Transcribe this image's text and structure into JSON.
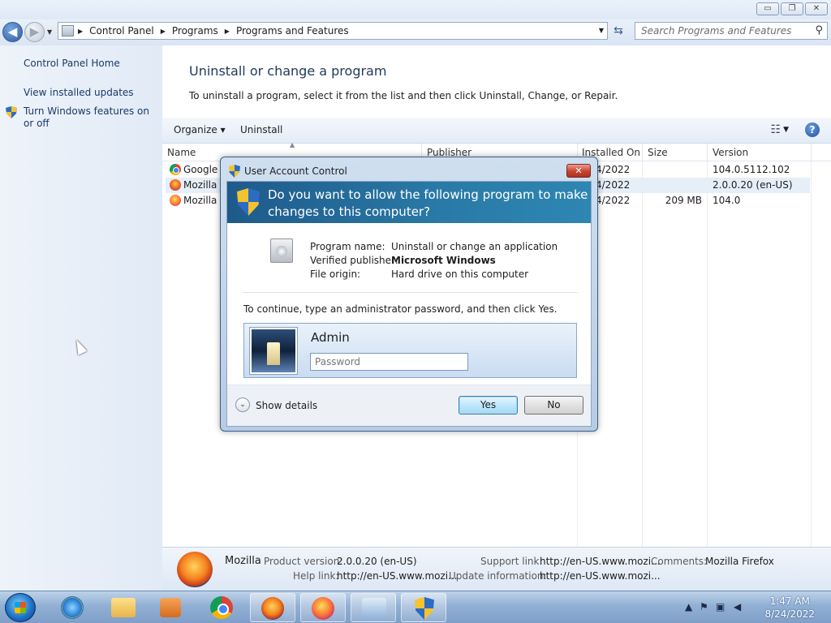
{
  "window": {
    "minimize": "▭",
    "maximize": "❐",
    "close": "✕"
  },
  "nav": {
    "back": "◀",
    "forward": "▶",
    "breadcrumbs": [
      "Control Panel",
      "Programs",
      "Programs and Features"
    ],
    "search_placeholder": "Search Programs and Features"
  },
  "sidebar": {
    "items": [
      {
        "label": "Control Panel Home"
      },
      {
        "label": "View installed updates"
      },
      {
        "label": "Turn Windows features on or off"
      }
    ]
  },
  "main": {
    "title": "Uninstall or change a program",
    "description": "To uninstall a program, select it from the list and then click Uninstall, Change, or Repair.",
    "toolbar": {
      "organize": "Organize ▾",
      "uninstall": "Uninstall",
      "help": "?"
    },
    "columns": [
      "Name",
      "Publisher",
      "Installed On",
      "Size",
      "Version"
    ],
    "rows": [
      {
        "name": "Google C",
        "installed": "4/2022",
        "size": "",
        "version": "104.0.5112.102",
        "icon": "chrome-icon"
      },
      {
        "name": "Mozilla F",
        "installed": "4/2022",
        "size": "",
        "version": "2.0.0.20 (en-US)",
        "icon": "mozilla-icon"
      },
      {
        "name": "Mozilla F",
        "installed": "4/2022",
        "size": "209 MB",
        "version": "104.0",
        "icon": "firefox-icon"
      }
    ]
  },
  "details": {
    "name": "Mozilla",
    "product_version_label": "Product version:",
    "product_version": "2.0.0.20 (en-US)",
    "support_link_label": "Support link:",
    "support_link": "http://en-US.www.mozi...",
    "comments_label": "Comments:",
    "comments": "Mozilla Firefox",
    "help_link_label": "Help link:",
    "help_link": "http://en-US.www.mozi...",
    "update_info_label": "Update information:",
    "update_info": "http://en-US.www.mozi..."
  },
  "uac": {
    "title": "User Account Control",
    "close": "✕",
    "question": "Do you want to allow the following program to make changes to this computer?",
    "program_name_label": "Program name:",
    "program_name": "Uninstall or change an application",
    "publisher_label": "Verified publisher:",
    "publisher": "Microsoft Windows",
    "origin_label": "File origin:",
    "origin": "Hard drive on this computer",
    "continue_text": "To continue, type an administrator password, and then click Yes.",
    "username": "Admin",
    "password_placeholder": "Password",
    "show_details_glyph": "⌄",
    "show_details": "Show details",
    "yes": "Yes",
    "no": "No"
  },
  "taskbar": {
    "time": "1:47 AM",
    "date": "8/24/2022"
  }
}
